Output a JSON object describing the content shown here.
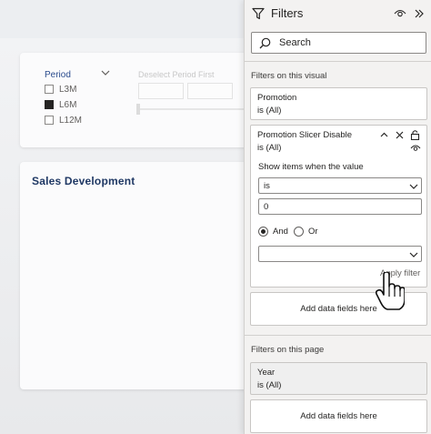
{
  "report": {
    "slicer": {
      "title": "Period",
      "options": [
        {
          "label": "L3M",
          "checked": false
        },
        {
          "label": "L6M",
          "checked": true
        },
        {
          "label": "L12M",
          "checked": false
        }
      ],
      "deselect_label": "Deselect Period First"
    },
    "sales_title": "Sales Development"
  },
  "filters_pane": {
    "title": "Filters",
    "search_placeholder": "Search",
    "visual_section_label": "Filters on this visual",
    "promotion_filter": {
      "name": "Promotion",
      "value": "is (All)"
    },
    "slicer_filter": {
      "name": "Promotion Slicer Disable",
      "value": "is (All)",
      "show_items_label": "Show items when the value",
      "operator": "is",
      "input_value": "0",
      "and_label": "And",
      "or_label": "Or",
      "logic_selected": "And",
      "second_operator": "",
      "apply_label": "Apply filter"
    },
    "add_fields_label_visual": "Add data fields here",
    "page_section_label": "Filters on this page",
    "year_filter": {
      "name": "Year",
      "value": "is (All)"
    },
    "add_fields_label_page": "Add data fields here"
  },
  "icons": {
    "filter": "filter-icon",
    "eye": "eye-icon",
    "collapse": "chevron-right-double-icon",
    "search": "search-icon",
    "chevron_up": "chevron-up-icon",
    "close": "close-icon",
    "lock": "lock-icon",
    "chevron_down": "chevron-down-icon",
    "cursor": "hand-pointer-icon"
  }
}
